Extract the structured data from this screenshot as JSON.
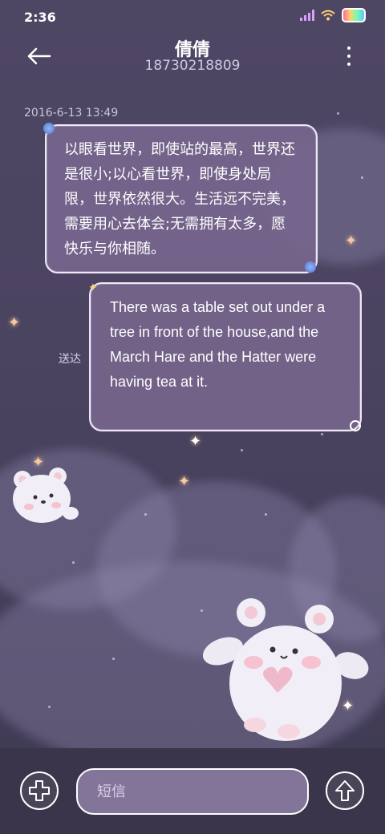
{
  "status": {
    "time": "2:36"
  },
  "header": {
    "name": "倩倩",
    "number": "18730218809"
  },
  "messages": [
    {
      "timestamp": "2016-6-13 13:49",
      "text": "以眼看世界，即使站的最高，世界还是很小;以心看世界，即使身处局限，世界依然很大。生活远不完美，需要用心去体会;无需拥有太多，愿快乐与你相随。"
    },
    {
      "status": "送达",
      "text": "There was a table set out under a tree in front of the house,and the March Hare and the Hatter were having tea at it."
    }
  ],
  "composer": {
    "placeholder": "短信"
  },
  "icons": {
    "back": "arrow-left-icon",
    "more": "more-vertical-icon",
    "add": "plus-icon",
    "send": "arrow-up-icon"
  },
  "colors": {
    "background": "#4b4461",
    "bubble": "#76658c",
    "bubble_border": "#efe8f8",
    "input_bar": "#3a354a",
    "input_field": "#837599"
  }
}
